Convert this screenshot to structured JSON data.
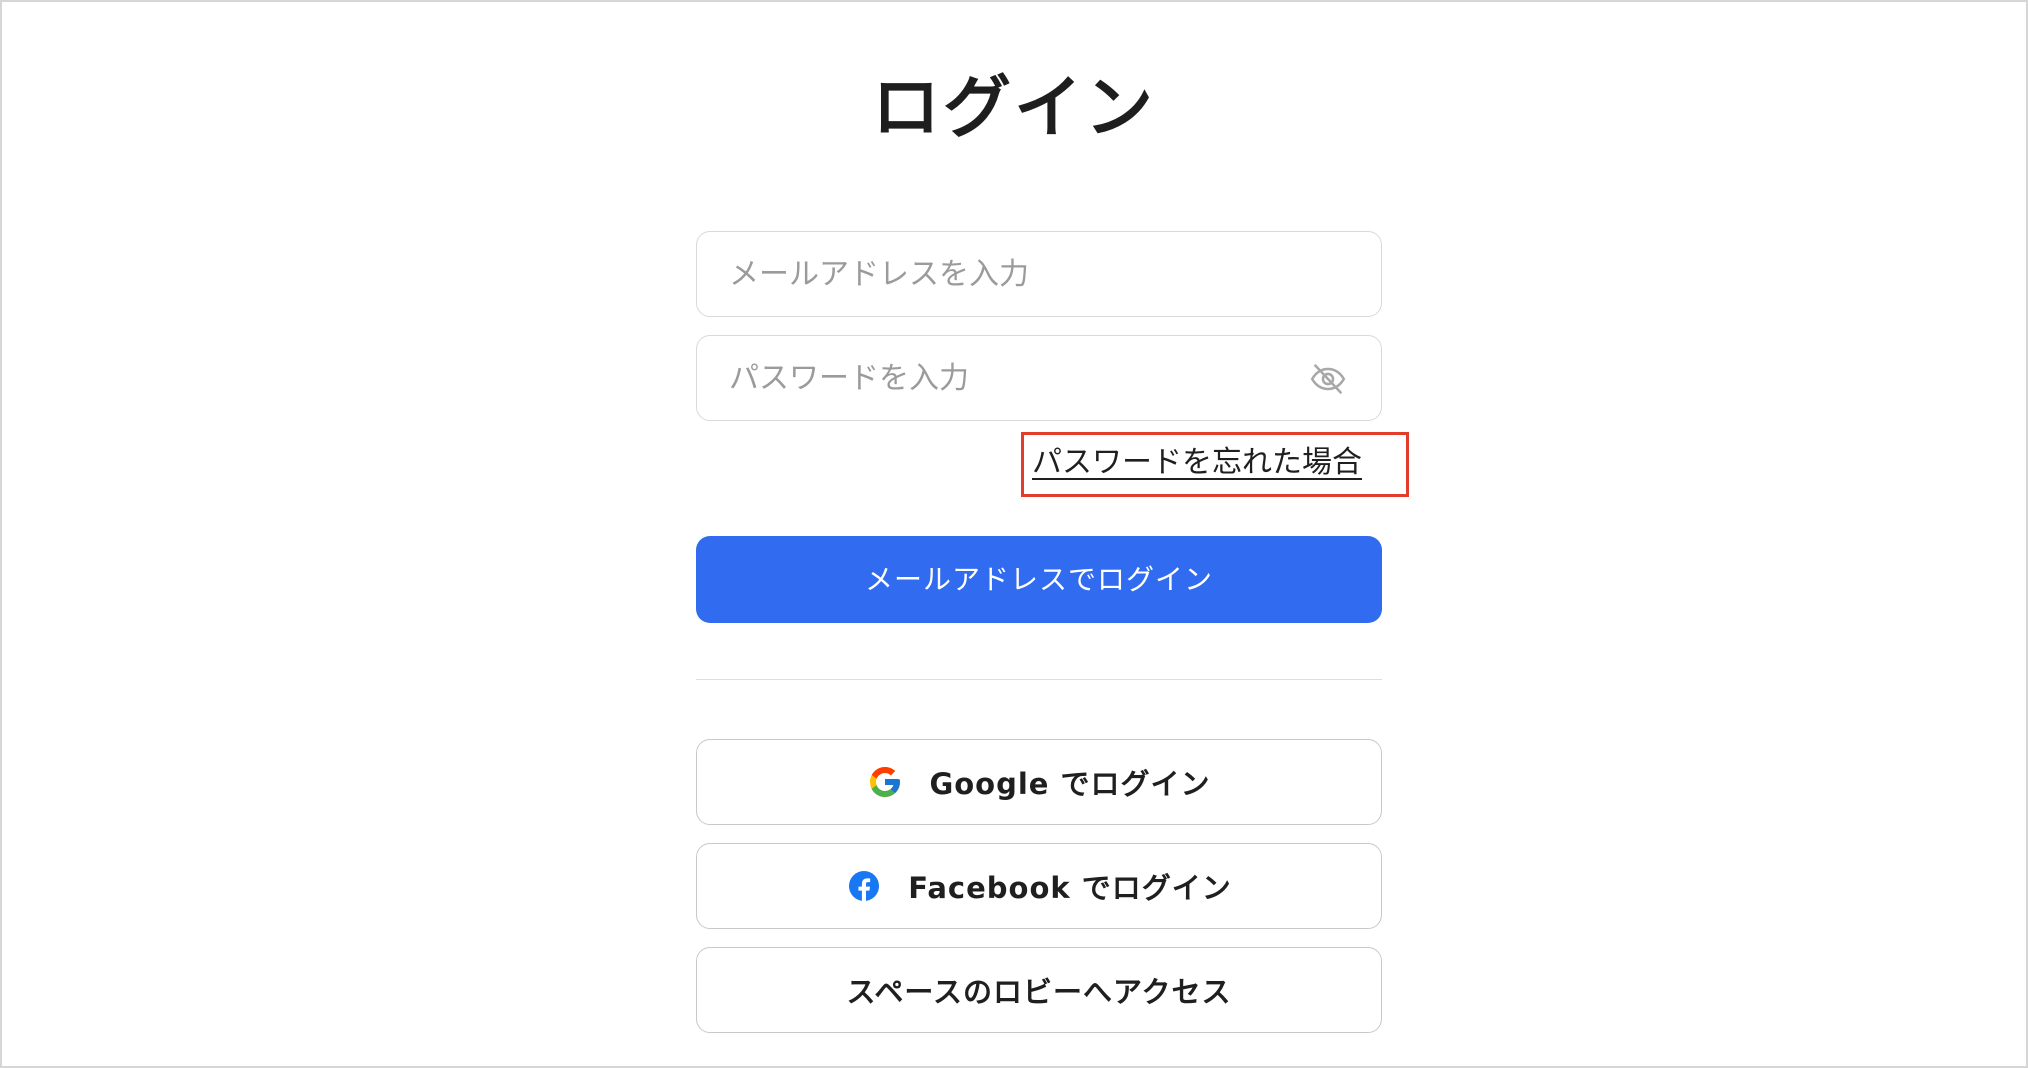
{
  "page": {
    "title": "ログイン"
  },
  "form": {
    "email_placeholder": "メールアドレスを入力",
    "password_placeholder": "パスワードを入力",
    "password_toggle_icon": "eye-off-icon",
    "forgot_password_link": "パスワードを忘れた場合",
    "submit_label": "メールアドレスでログイン"
  },
  "social": {
    "google_label": "Google でログイン",
    "google_icon": "google-icon",
    "facebook_label": "Facebook でログイン",
    "facebook_icon": "facebook-icon",
    "lobby_label": "スペースのロビーへアクセス"
  },
  "colors": {
    "primary": "#316CF0",
    "highlight_border": "#E23D2A",
    "facebook": "#1877F2"
  }
}
